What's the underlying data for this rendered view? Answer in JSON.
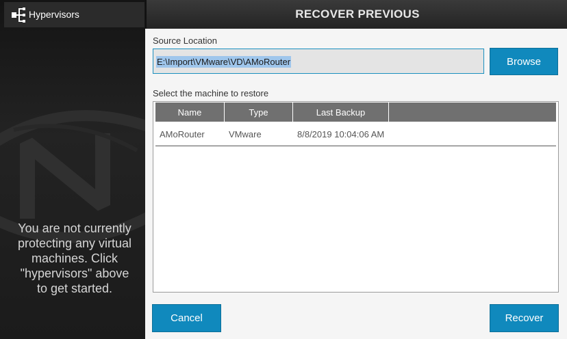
{
  "sidebar": {
    "hypervisors_label": "Hypervisors",
    "hypervisors_icon": "hierarchy-icon",
    "empty_message": "You are not currently protecting any virtual machines. Click \"hypervisors\" above to get started."
  },
  "dialog": {
    "title": "RECOVER PREVIOUS",
    "source_location_label": "Source Location",
    "source_location_value": "E:\\Import\\VMware\\VD\\AMoRouter",
    "browse_label": "Browse",
    "select_machine_label": "Select the machine to restore",
    "table": {
      "columns": [
        "Name",
        "Type",
        "Last Backup",
        ""
      ],
      "rows": [
        {
          "name": "AMoRouter",
          "type": "VMware",
          "last_backup": "8/8/2019 10:04:06 AM"
        }
      ]
    },
    "cancel_label": "Cancel",
    "recover_label": "Recover"
  },
  "colors": {
    "accent": "#1089bd",
    "header_bg": "#707070",
    "sidebar_bg": "#1a1a1a"
  }
}
